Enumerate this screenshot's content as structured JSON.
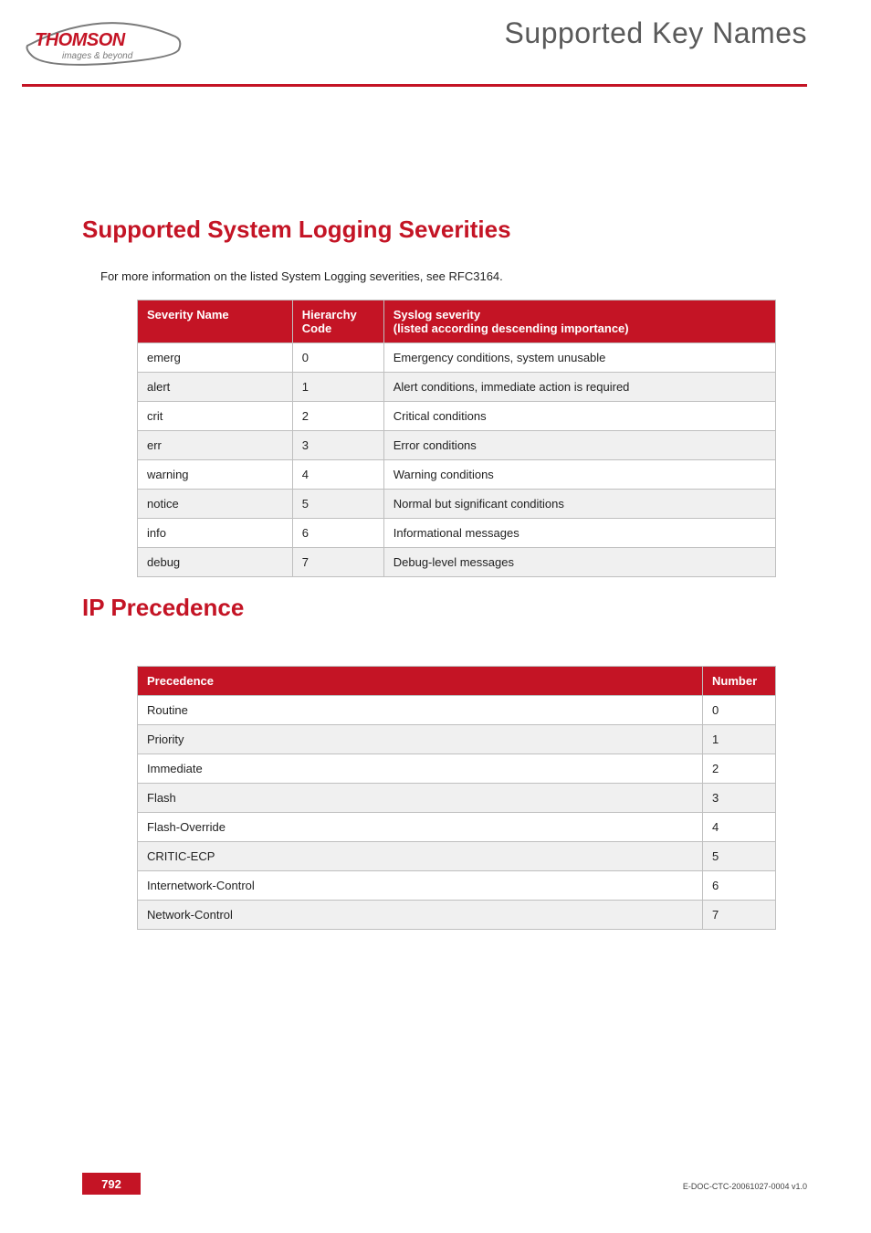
{
  "header": {
    "running_title": "Supported Key Names",
    "logo_brand": "THOMSON",
    "logo_tagline": "images & beyond"
  },
  "section1": {
    "title": "Supported System Logging Severities",
    "intro": "For more information on the listed System Logging severities, see RFC3164.",
    "columns": {
      "name": "Severity Name",
      "code": "Hierarchy Code",
      "desc": "Syslog severity\n(listed according descending importance)"
    },
    "rows": [
      {
        "name": "emerg",
        "code": "0",
        "desc": "Emergency conditions, system unusable"
      },
      {
        "name": "alert",
        "code": "1",
        "desc": "Alert conditions, immediate action is required"
      },
      {
        "name": "crit",
        "code": "2",
        "desc": "Critical conditions"
      },
      {
        "name": "err",
        "code": "3",
        "desc": "Error conditions"
      },
      {
        "name": "warning",
        "code": "4",
        "desc": "Warning conditions"
      },
      {
        "name": "notice",
        "code": "5",
        "desc": "Normal but significant conditions"
      },
      {
        "name": "info",
        "code": "6",
        "desc": "Informational messages"
      },
      {
        "name": "debug",
        "code": "7",
        "desc": "Debug-level messages"
      }
    ]
  },
  "section2": {
    "title": "IP Precedence",
    "columns": {
      "precedence": "Precedence",
      "number": "Number"
    },
    "rows": [
      {
        "precedence": "Routine",
        "number": "0"
      },
      {
        "precedence": "Priority",
        "number": "1"
      },
      {
        "precedence": "Immediate",
        "number": "2"
      },
      {
        "precedence": "Flash",
        "number": "3"
      },
      {
        "precedence": "Flash-Override",
        "number": "4"
      },
      {
        "precedence": "CRITIC-ECP",
        "number": "5"
      },
      {
        "precedence": "Internetwork-Control",
        "number": "6"
      },
      {
        "precedence": "Network-Control",
        "number": "7"
      }
    ]
  },
  "footer": {
    "page_number": "792",
    "doc_id": "E-DOC-CTC-20061027-0004 v1.0"
  },
  "chart_data": [
    {
      "type": "table",
      "title": "Supported System Logging Severities",
      "columns": [
        "Severity Name",
        "Hierarchy Code",
        "Syslog severity (listed according descending importance)"
      ],
      "rows": [
        [
          "emerg",
          0,
          "Emergency conditions, system unusable"
        ],
        [
          "alert",
          1,
          "Alert conditions, immediate action is required"
        ],
        [
          "crit",
          2,
          "Critical conditions"
        ],
        [
          "err",
          3,
          "Error conditions"
        ],
        [
          "warning",
          4,
          "Warning conditions"
        ],
        [
          "notice",
          5,
          "Normal but significant conditions"
        ],
        [
          "info",
          6,
          "Informational messages"
        ],
        [
          "debug",
          7,
          "Debug-level messages"
        ]
      ]
    },
    {
      "type": "table",
      "title": "IP Precedence",
      "columns": [
        "Precedence",
        "Number"
      ],
      "rows": [
        [
          "Routine",
          0
        ],
        [
          "Priority",
          1
        ],
        [
          "Immediate",
          2
        ],
        [
          "Flash",
          3
        ],
        [
          "Flash-Override",
          4
        ],
        [
          "CRITIC-ECP",
          5
        ],
        [
          "Internetwork-Control",
          6
        ],
        [
          "Network-Control",
          7
        ]
      ]
    }
  ]
}
